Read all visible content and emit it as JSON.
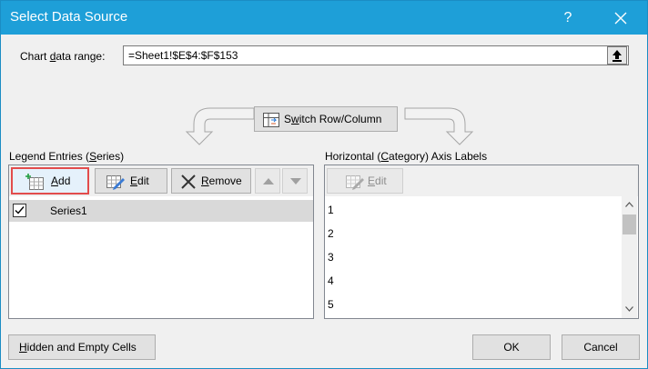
{
  "window": {
    "title": "Select Data Source",
    "help_label": "?"
  },
  "chart_data_range": {
    "label_pre": "Chart ",
    "label_accel": "d",
    "label_post": "ata range:",
    "value": "=Sheet1!$E$4:$F$153"
  },
  "switch_button": {
    "icon": "switch-row-column-icon",
    "label_pre": "S",
    "label_accel": "w",
    "label_post": "itch Row/Column"
  },
  "legend": {
    "heading_pre": "Legend Entries (",
    "heading_accel": "S",
    "heading_post": "eries)",
    "buttons": {
      "add": {
        "accel": "A",
        "rest": "dd",
        "icon": "add-series-icon"
      },
      "edit": {
        "accel": "E",
        "rest": "dit",
        "icon": "edit-series-icon"
      },
      "remove": {
        "accel": "R",
        "rest": "emove",
        "icon": "remove-icon"
      },
      "move_up_icon": "triangle-up-icon",
      "move_down_icon": "triangle-down-icon"
    },
    "series": [
      {
        "name": "Series1",
        "checked": true
      }
    ]
  },
  "axis_labels": {
    "heading_pre": "Horizontal (",
    "heading_accel": "C",
    "heading_post": "ategory) Axis Labels",
    "edit_label_accel": "E",
    "edit_label_rest": "dit",
    "edit_icon": "edit-axis-icon",
    "items": [
      "1",
      "2",
      "3",
      "4",
      "5"
    ]
  },
  "footer": {
    "hidden_empty": {
      "accel": "H",
      "rest": "idden and Empty Cells"
    },
    "ok": "OK",
    "cancel": "Cancel"
  },
  "colors": {
    "title_bar": "#1e9fd8",
    "focus_outline": "#e24c4c",
    "selection_row": "#d9d9d9"
  }
}
